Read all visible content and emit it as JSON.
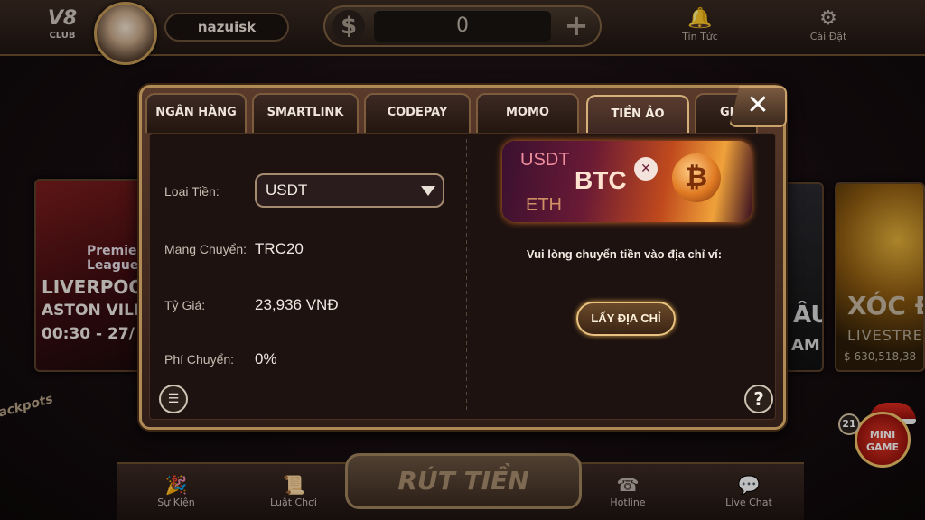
{
  "topbar": {
    "logo_top": "V8",
    "logo_sub": "CLUB",
    "username": "nazuisk",
    "currency_symbol": "$",
    "balance": "0",
    "plus": "+",
    "news_label": "Tin Tức",
    "settings_label": "Cài Đặt"
  },
  "background": {
    "liverpool_card": {
      "league": "Premier League",
      "line1": "LIVERPOOL",
      "line2": "ASTON VILL",
      "line3": "00:30 - 27/"
    },
    "middle_card": {
      "line1": "ÂU",
      "line2": "AM"
    },
    "xocdia_card": {
      "title": "XÓC ĐĨ",
      "subtitle": "LIVESTREA",
      "jackpot": "$ 630,518,38"
    },
    "jackpot_logo": "Jackpots"
  },
  "dialog": {
    "tabs": [
      {
        "label": "NGÂN HÀNG",
        "active": false
      },
      {
        "label": "SMARTLINK",
        "active": false
      },
      {
        "label": "CODEPAY",
        "active": false
      },
      {
        "label": "MOMO",
        "active": false
      },
      {
        "label": "TIỀN ẢO",
        "active": true
      },
      {
        "label": "GI",
        "active": false
      }
    ],
    "close_symbol": "✕",
    "fields": {
      "currency_type_label": "Loại Tiền:",
      "currency_type_value": "USDT",
      "network_label": "Mạng Chuyển:",
      "network_value": "TRC20",
      "rate_label": "Tỷ Giá:",
      "rate_value": "23,936 VNĐ",
      "fee_label": "Phí Chuyển:",
      "fee_value": "0%"
    },
    "banner": {
      "usdt": "USDT",
      "btc": "BTC",
      "eth": "ETH",
      "coin_symbol": "₿",
      "ripple_symbol": "✕"
    },
    "transfer_message": "Vui lòng chuyển tiền vào địa chỉ ví:",
    "get_address_label": "LẤY ĐỊA CHỈ",
    "help_symbol": "?",
    "notes_symbol": "☰"
  },
  "bottombar": {
    "events_label": "Sự Kiện",
    "rules_label": "Luật Chơi",
    "withdraw_label": "RÚT TIỀN",
    "hotline_label": "Hotline",
    "livechat_label": "Live Chat"
  },
  "minigame": {
    "label_line1": "MINI",
    "label_line2": "GAME",
    "badge": "21"
  }
}
